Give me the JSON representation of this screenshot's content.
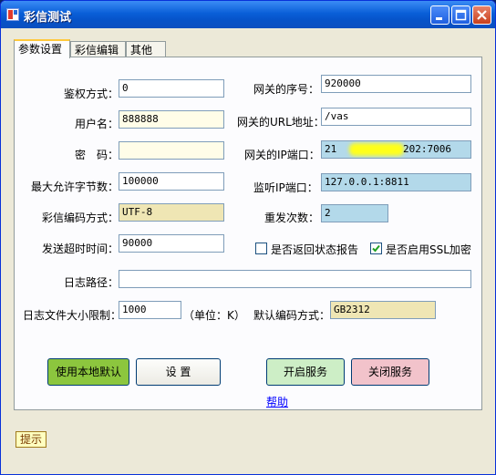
{
  "window": {
    "title": "彩信测试"
  },
  "tabs": [
    {
      "label": "参数设置"
    },
    {
      "label": "彩信编辑"
    },
    {
      "label": "其他"
    }
  ],
  "left": {
    "auth_label": "鉴权方式：",
    "auth_value": "0",
    "user_label": "用户名：",
    "user_value": "888888",
    "password_label": "密　码：",
    "password_value": "",
    "maxbytes_label": "最大允许字节数：",
    "maxbytes_value": "100000",
    "encoding_label": "彩信编码方式：",
    "encoding_value": "UTF-8",
    "timeout_label": "发送超时时间：",
    "timeout_value": "90000",
    "logpath_label": "日志路径：",
    "logpath_value": "",
    "logsize_label": "日志文件大小限制：",
    "logsize_value": "1000",
    "unit_label": "（单位：K）"
  },
  "right": {
    "seq_label": "网关的序号：",
    "seq_value": "920000",
    "url_label": "网关的URL地址：",
    "url_value": "/vas",
    "ip_label": "网关的IP端口：",
    "ip_value_prefix": "21",
    "ip_value_suffix": "202:7006",
    "listen_label": "监听IP端口：",
    "listen_value": "127.0.0.1:8811",
    "retry_label": "重发次数：",
    "retry_value": "2",
    "report_label": "是否返回状态报告",
    "ssl_label": "是否启用SSL加密",
    "default_enc_label": "默认编码方式：",
    "default_enc_value": "GB2312"
  },
  "checkboxes": {
    "report_checked": false,
    "ssl_checked": true
  },
  "buttons": {
    "use_default": "使用本地默认",
    "settings": "设  置",
    "start": "开启服务",
    "stop": "关闭服务",
    "help": "帮助"
  },
  "status": {
    "hint": "提示"
  },
  "colors": {
    "titlebar": "#0a5fd8",
    "green_button": "#8cc63e",
    "start_button": "#cdeec6",
    "stop_button": "#f2c3cb",
    "ivory_field": "#fffde8",
    "tan_field": "#efe6b4",
    "blue_field": "#b3d9ea"
  }
}
